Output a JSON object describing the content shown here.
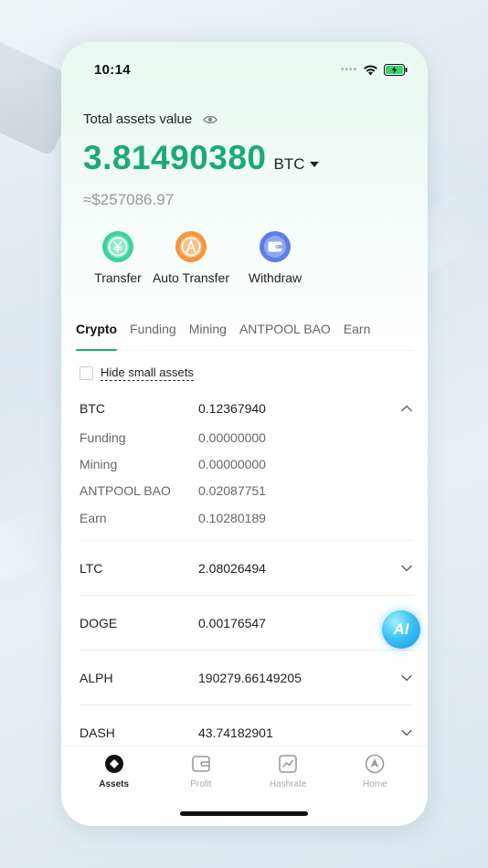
{
  "status_bar": {
    "time": "10:14"
  },
  "assets": {
    "total_label": "Total assets value",
    "balance": "3.81490380",
    "unit": "BTC",
    "usd_value": "≈$257086.97"
  },
  "actions": [
    {
      "label": "Transfer"
    },
    {
      "label": "Auto Transfer"
    },
    {
      "label": "Withdraw"
    }
  ],
  "tabs": [
    "Crypto",
    "Funding",
    "Mining",
    "ANTPOOL BAO",
    "Earn"
  ],
  "hide_small_label": "Hide small assets",
  "coins": {
    "btc": {
      "name": "BTC",
      "value": "0.12367940",
      "details": [
        {
          "name": "Funding",
          "value": "0.00000000"
        },
        {
          "name": "Mining",
          "value": "0.00000000"
        },
        {
          "name": "ANTPOOL BAO",
          "value": "0.02087751"
        },
        {
          "name": "Earn",
          "value": "0.10280189"
        }
      ]
    },
    "ltc": {
      "name": "LTC",
      "value": "2.08026494"
    },
    "doge": {
      "name": "DOGE",
      "value": "0.00176547"
    },
    "alph": {
      "name": "ALPH",
      "value": "190279.66149205"
    },
    "dash": {
      "name": "DASH",
      "value": "43.74182901"
    }
  },
  "ai_badge": "AI",
  "nav": [
    {
      "label": "Assets"
    },
    {
      "label": "Profit"
    },
    {
      "label": "Hashrate"
    },
    {
      "label": "Home"
    }
  ],
  "colors": {
    "accent": "#1aa97c",
    "transfer": "#3ed3a0",
    "auto_transfer": "#f7953f",
    "withdraw": "#5b7fe8"
  }
}
